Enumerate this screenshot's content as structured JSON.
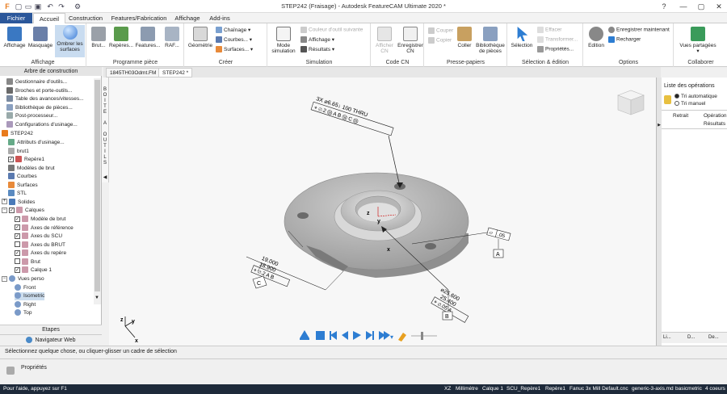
{
  "window": {
    "title": "STEP242 (Fraisage) - Autodesk FeatureCAM Ultimate 2020 *"
  },
  "ribbon_tabs": [
    "Fichier",
    "Accueil",
    "Construction",
    "Features/Fabrication",
    "Affichage",
    "Add-ins"
  ],
  "ribbon": {
    "affichage_group": {
      "label": "Affichage",
      "buttons": [
        "Affichage",
        "Masquage",
        "Ombrer les surfaces"
      ]
    },
    "programme_group": {
      "label": "Programme pièce",
      "buttons": [
        "Brut...",
        "Repères...",
        "Features...",
        "RAF..."
      ]
    },
    "creer_group": {
      "label": "Créer",
      "buttons": [
        "Géométrie",
        "Chaînage",
        "Courbes...",
        "Surfaces..."
      ]
    },
    "simulation_group": {
      "label": "Simulation",
      "buttons": [
        "Mode simulation",
        "Couleur d'outil suivante",
        "Affichage",
        "Résultats"
      ]
    },
    "codecn_group": {
      "label": "Code CN",
      "buttons": [
        "Afficher CN",
        "Enregistrer CN"
      ]
    },
    "presse_group": {
      "label": "Presse-papiers",
      "buttons": [
        "Couper",
        "Copier",
        "Coller",
        "Bibliothèque de pièces"
      ]
    },
    "selection_group": {
      "label": "Sélection & édition",
      "buttons": [
        "Sélection",
        "Effacer",
        "Transformer...",
        "Propriétés..."
      ]
    },
    "options_group": {
      "label": "Options",
      "buttons": [
        "Edition",
        "Enregistrer maintenant",
        "Recharger"
      ]
    },
    "collab_group": {
      "label": "Collaborer",
      "buttons": [
        "Vues partagées"
      ]
    }
  },
  "tree": {
    "header": "Arbre de construction",
    "items": [
      "Gestionnaire d'outils...",
      "Broches et porte-outils...",
      "Table des avances/vitesses...",
      "Bibliothèque de pièces...",
      "Post-processeur...",
      "Configurations d'usinage...",
      "STEP242",
      "Attributs d'usinage...",
      "brut1",
      "Repère1",
      "Modèles de brut",
      "Courbes",
      "Surfaces",
      "STL",
      "Solides",
      "Calques",
      "Modèle de brut",
      "Axes de référence",
      "Axes du SCU",
      "Axes du BRUT",
      "Axes du repère",
      "Brut",
      "Calque 1",
      "Vues perso",
      "Front",
      "Isometric",
      "Right",
      "Top"
    ],
    "etapes": "Etapes",
    "navweb": "Navigateur Web"
  },
  "vertical_toolbar": "BOITE A OUTILS",
  "doc_tabs": [
    "1845TH03Odmt.FM",
    "STEP242 *"
  ],
  "dims": {
    "callout1": [
      "3X ⌀6.65↓ 100 THRU",
      "⌖ ⌀.2 Ⓜ A B Ⓜ C Ⓜ"
    ],
    "callout2": [
      "19.000",
      "18.900",
      "⌖ ⌀.2 A B"
    ],
    "callout3": [
      "⌀25.600",
      "25.400",
      "⌖ ⌀.05 A"
    ],
    "flatness": ".05",
    "datums": [
      "A",
      "B",
      "C"
    ]
  },
  "right_panel": {
    "title": "Liste des opérations",
    "radio1": "Tri automatique",
    "radio2": "Tri manuel",
    "cols": [
      "Retrait",
      "Opération",
      "Résultats"
    ],
    "bottom_tabs": [
      "Li...",
      "D...",
      "De..."
    ]
  },
  "status": "Sélectionnez quelque chose, ou cliquer-glisser un cadre de sélection",
  "properties": "Propriétés",
  "bottombar": {
    "help": "Pour l'aide, appuyez sur F1",
    "items": [
      "XZ",
      "Millimètre",
      "Calque 1",
      "SCU_Repère1",
      "Repère1",
      "Fanuc 3x Mill Default.cnc",
      "generic-3-axis.md",
      "basicmetric",
      "4 coeurs"
    ]
  },
  "colors": {
    "accent": "#2b579a",
    "statusbar": "#1e2a3a",
    "part": "#b8b8b8"
  }
}
